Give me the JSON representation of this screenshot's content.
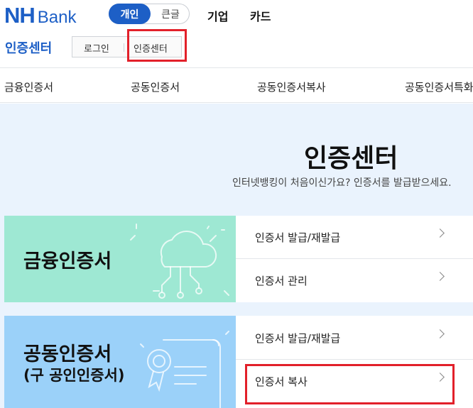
{
  "header": {
    "logo_nh": "NH",
    "logo_bank": "Bank",
    "segment": {
      "active": "개인",
      "inactive": "큰글"
    },
    "top_nav": [
      "기업",
      "카드"
    ],
    "section_title": "인증센터",
    "util": {
      "login": "로그인",
      "cert_center": "인증센터"
    }
  },
  "tabs": [
    "금융인증서",
    "공동인증서",
    "공동인증서복사",
    "공동인증서특화"
  ],
  "main": {
    "title": "인증센터",
    "subtitle": "인터넷뱅킹이 처음이신가요? 인증서를 발급받으세요."
  },
  "cards": [
    {
      "title": "금융인증서",
      "subtitle": "",
      "items": [
        "인증서 발급/재발급",
        "인증서 관리"
      ]
    },
    {
      "title": "공동인증서",
      "subtitle": "(구 공인인증서)",
      "items": [
        "인증서 발급/재발급",
        "인증서 복사"
      ]
    }
  ],
  "colors": {
    "brand": "#1d5fc6",
    "card1_hero": "#9ee8d3",
    "card2_hero": "#9bd1f9",
    "content_bg": "#eaf3fd",
    "highlight": "#e2202a"
  },
  "icons": {
    "card1": "cloud-network-icon",
    "card2": "certificate-scroll-icon",
    "menu_arrow": "chevron-right-icon"
  }
}
